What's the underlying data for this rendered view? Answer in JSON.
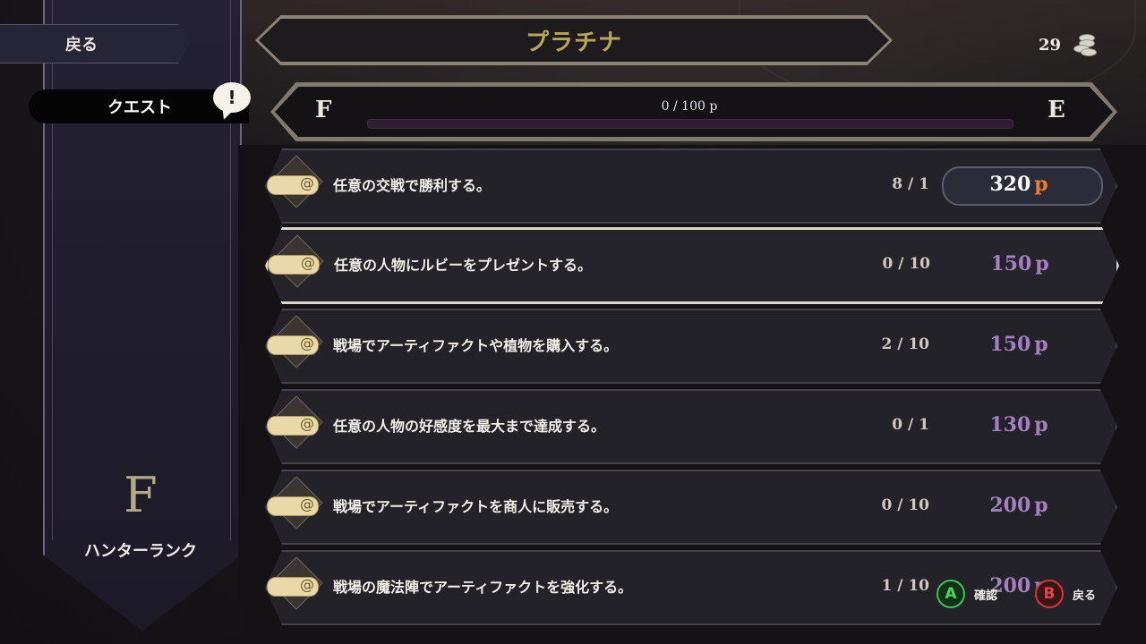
{
  "sidebar": {
    "back_label": "戻る",
    "quest_tab_label": "クエスト",
    "alert_mark": "!",
    "rank_letter": "F",
    "rank_label": "ハンターランク"
  },
  "header": {
    "title": "プラチナ",
    "currency_amount": "29",
    "currency_icon": "coin-stack-icon"
  },
  "rank_progress": {
    "current_rank": "F",
    "next_rank": "E",
    "text": "0 / 100 p",
    "current": 0,
    "max": 100
  },
  "quests": [
    {
      "text": "任意の交戦で勝利する。",
      "progress": "8 / 1",
      "points": "320",
      "unit": "p",
      "claimable": true
    },
    {
      "text": "任意の人物にルビーをプレゼントする。",
      "progress": "0 / 10",
      "points": "150",
      "unit": "p",
      "claimable": false
    },
    {
      "text": "戦場でアーティファクトや植物を購入する。",
      "progress": "2 / 10",
      "points": "150",
      "unit": "p",
      "claimable": false
    },
    {
      "text": "任意の人物の好感度を最大まで達成する。",
      "progress": "0 / 1",
      "points": "130",
      "unit": "p",
      "claimable": false
    },
    {
      "text": "戦場でアーティファクトを商人に販売する。",
      "progress": "0 / 10",
      "points": "200",
      "unit": "p",
      "claimable": false
    },
    {
      "text": "戦場の魔法陣でアーティファクトを強化する。",
      "progress": "1 / 10",
      "points": "200",
      "unit": "p",
      "claimable": false
    }
  ],
  "hints": {
    "a_button": "A",
    "a_label": "確認",
    "b_button": "B",
    "b_label": "戻る"
  },
  "colors": {
    "accent_gold": "#b6a658",
    "reward_purple": "#a47fc2",
    "claim_orange": "#f07a2a"
  }
}
